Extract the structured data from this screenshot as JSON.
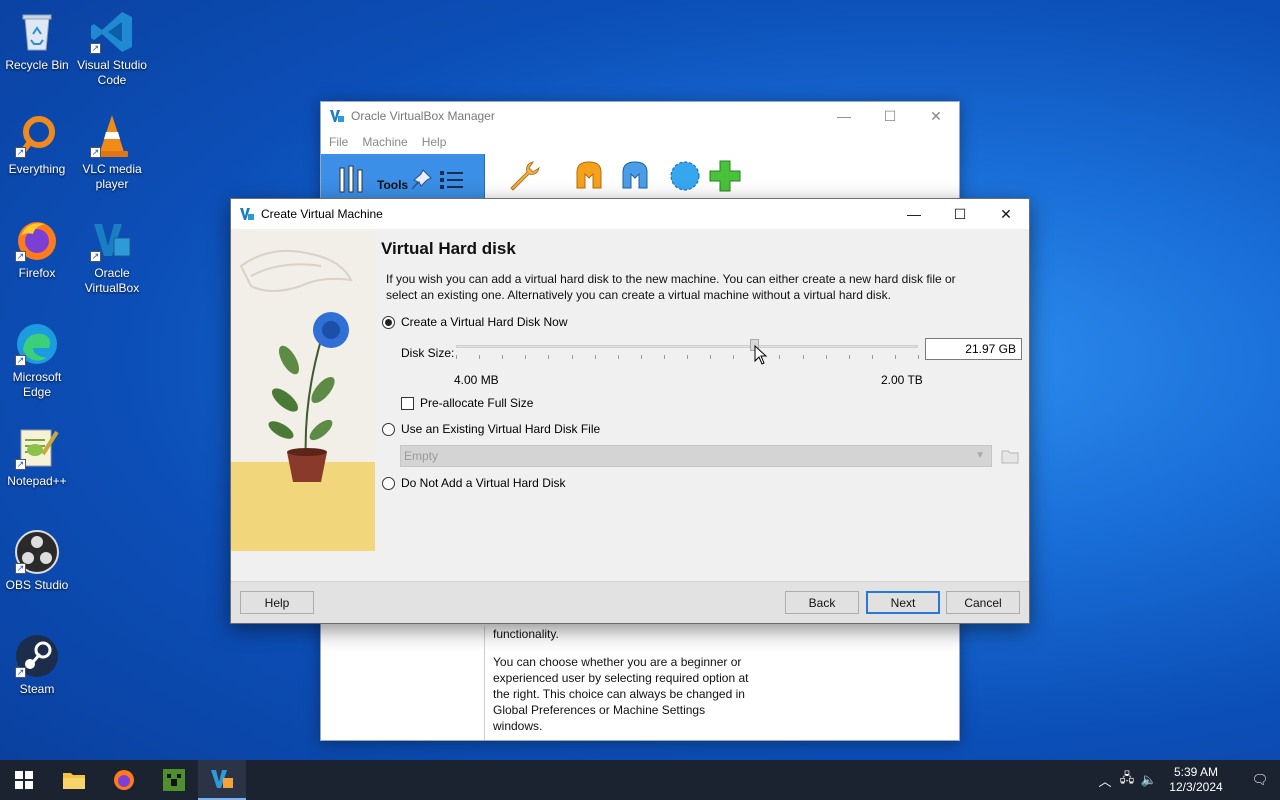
{
  "desktop": {
    "icons": [
      {
        "label": "Recycle Bin"
      },
      {
        "label": "Visual Studio Code"
      },
      {
        "label": "Everything"
      },
      {
        "label": "VLC media player"
      },
      {
        "label": "Firefox"
      },
      {
        "label": "Oracle VirtualBox"
      },
      {
        "label": "Microsoft Edge"
      },
      {
        "label": "Notepad++"
      },
      {
        "label": "OBS Studio"
      },
      {
        "label": "Steam"
      }
    ]
  },
  "manager": {
    "title": "Oracle VirtualBox Manager",
    "menu": [
      "File",
      "Machine",
      "Help"
    ],
    "tools_label": "Tools",
    "description": [
      "functionality.",
      "You can choose whether you are a beginner or experienced user by selecting required option at the right. This choice can always be changed in Global Preferences or Machine Settings windows."
    ]
  },
  "dialog": {
    "title": "Create Virtual Machine",
    "heading": "Virtual Hard disk",
    "intro": "If you wish you can add a virtual hard disk to the new machine. You can either create a new hard disk file or select an existing one. Alternatively you can create a virtual machine without a virtual hard disk.",
    "option_create": "Create a Virtual Hard Disk Now",
    "disk_size_label": "Disk Size:",
    "disk_size_value": "21.97 GB",
    "slider_min": "4.00 MB",
    "slider_max": "2.00 TB",
    "slider_position": 0.645,
    "preallocate": "Pre-allocate Full Size",
    "option_existing": "Use an Existing Virtual Hard Disk File",
    "existing_combo": "Empty",
    "option_none": "Do Not Add a Virtual Hard Disk",
    "buttons": {
      "help": "Help",
      "back": "Back",
      "next": "Next",
      "cancel": "Cancel"
    }
  },
  "taskbar": {
    "time": "5:39 AM",
    "date": "12/3/2024"
  }
}
